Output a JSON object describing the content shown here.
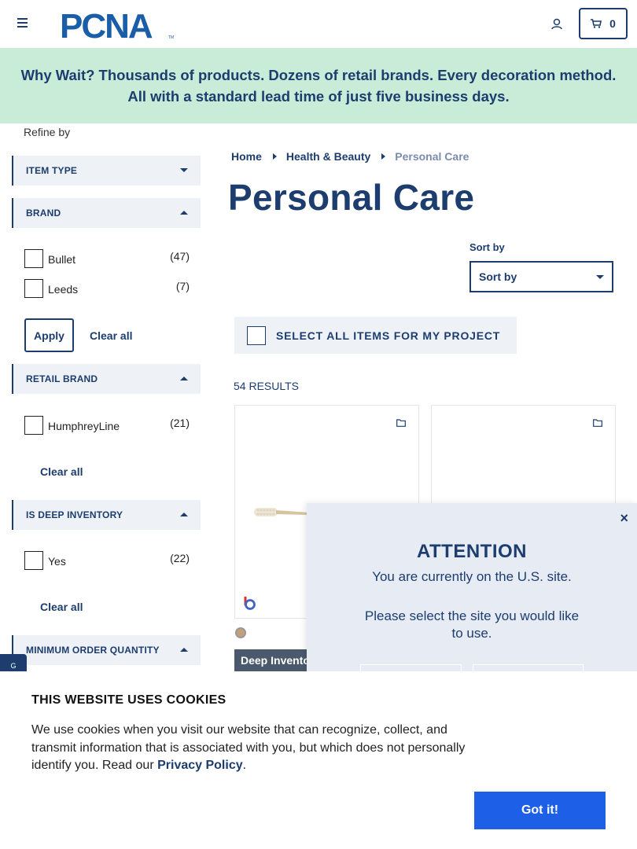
{
  "header": {
    "logo_text": "PCNA",
    "logo_tm": "TM",
    "menu_icon": "hamburger-icon",
    "user_icon": "user-icon",
    "cart_icon": "cart-icon",
    "cart_count": "0"
  },
  "banner": {
    "text": "Why Wait? Thousands of products. Dozens of retail brands. Every decoration method. All with a standard lead time of just five business days.",
    "color": "#c9ecd9"
  },
  "sidebar": {
    "refine_label": "Refine by",
    "facets": {
      "item_type": {
        "title": "ITEM TYPE"
      },
      "brand": {
        "title": "BRAND",
        "options": [
          {
            "label": "Bullet",
            "count": "(47)"
          },
          {
            "label": "Leeds",
            "count": "(7)"
          }
        ],
        "apply_label": "Apply",
        "clear_label": "Clear all"
      },
      "retail_brand": {
        "title": "RETAIL BRAND",
        "options": [
          {
            "label": "HumphreyLine",
            "count": "(21)"
          }
        ],
        "clear_label": "Clear all"
      },
      "deep_inventory": {
        "title": "IS DEEP INVENTORY",
        "options": [
          {
            "label": "Yes",
            "count": "(22)"
          }
        ],
        "clear_label": "Clear all"
      },
      "min_order": {
        "title": "MINIMUM ORDER QUANTITY"
      }
    }
  },
  "main": {
    "breadcrumb": [
      "Home",
      "Health & Beauty",
      "Personal Care"
    ],
    "title": "Personal Care",
    "sort": {
      "label": "Sort by",
      "value": "Sort by"
    },
    "select_all_label": "SELECT ALL ITEMS FOR MY PROJECT",
    "results": "54 RESULTS",
    "cards": [
      {
        "badge": "Deep Inventory",
        "swatch": "#c59f7c"
      },
      {}
    ]
  },
  "feedback_tab": {
    "label": "G"
  },
  "modal": {
    "close": "×",
    "title": "ATTENTION",
    "message": "You are currently on the U.S. site.",
    "prompt": "Please select the site you would like to use."
  },
  "cookie": {
    "heading": "THIS WEBSITE USES COOKIES",
    "body": "We use cookies when you visit our website that can recognize, collect, and transmit information that is associated with you, but which does not personally identify you. Read our ",
    "policy_link": "Privacy Policy",
    "period": ".",
    "button": "Got it!",
    "button_color": "#1d5fe6"
  },
  "colors": {
    "brand_navy": "#1c3d6e",
    "facet_bg": "#eef1f6"
  }
}
